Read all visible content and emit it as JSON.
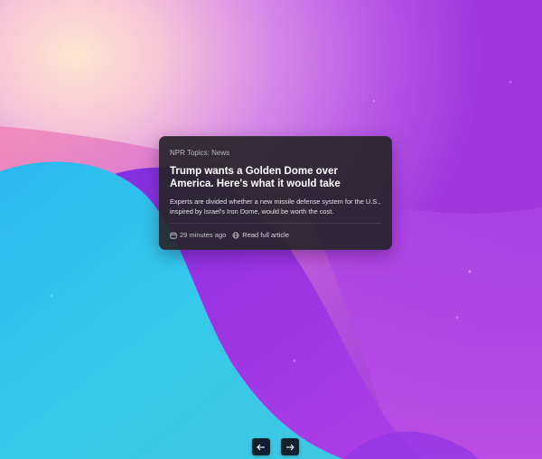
{
  "card": {
    "source": "NPR Topics: News",
    "title": "Trump wants a Golden Dome over America. Here's what it would take",
    "description": "Experts are divided whether a new missile defense system for the U.S., inspired by Israel's Iron Dome, would be worth the cost.",
    "time_ago": "29 minutes ago",
    "read_link": "Read full article",
    "time_icon": "calendar-icon",
    "link_icon": "globe-icon"
  },
  "navigation": {
    "prev_icon": "arrow-left-icon",
    "next_icon": "arrow-right-icon"
  },
  "colors": {
    "card_background": "#262428",
    "nav_button_background": "#11202e",
    "wallpaper_purple": "#a63ce0",
    "wallpaper_cyan": "#2fc6ec",
    "wallpaper_pink": "#f6a9c9"
  }
}
